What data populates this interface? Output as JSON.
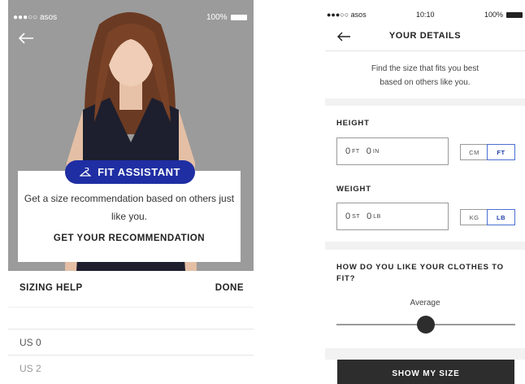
{
  "left": {
    "status": {
      "carrier": "●●●○○ asos",
      "battery": "100%"
    },
    "fit_assistant": {
      "pill_label": "FIT ASSISTANT",
      "description": "Get a size recommendation based on others just like you.",
      "cta": "GET YOUR RECOMMENDATION"
    },
    "sizing_help": "SIZING HELP",
    "done": "DONE",
    "sizes": [
      "US 0",
      "US 2"
    ]
  },
  "right": {
    "status": {
      "carrier": "●●●○○ asos",
      "time": "10:10",
      "battery": "100%"
    },
    "title": "YOUR DETAILS",
    "intro": "Find the size that fits you best based on others like you.",
    "height": {
      "label": "HEIGHT",
      "ft_value": "0",
      "ft_unit": "FT",
      "in_value": "0",
      "in_unit": "IN",
      "toggle": [
        "CM",
        "FT"
      ],
      "selected": "FT"
    },
    "weight": {
      "label": "WEIGHT",
      "st_value": "0",
      "st_unit": "ST",
      "lb_value": "0",
      "lb_unit": "LB",
      "toggle": [
        "KG",
        "LB"
      ],
      "selected": "LB"
    },
    "fit_question": "HOW DO YOU LIKE YOUR CLOTHES TO FIT?",
    "fit_value": "Average",
    "slider_position": 0.5,
    "show_button": "SHOW MY SIZE"
  },
  "colors": {
    "brand_blue": "#1f2ea3",
    "dark_button": "#2d2d2d",
    "toggle_selected": "#4a6fd0"
  }
}
